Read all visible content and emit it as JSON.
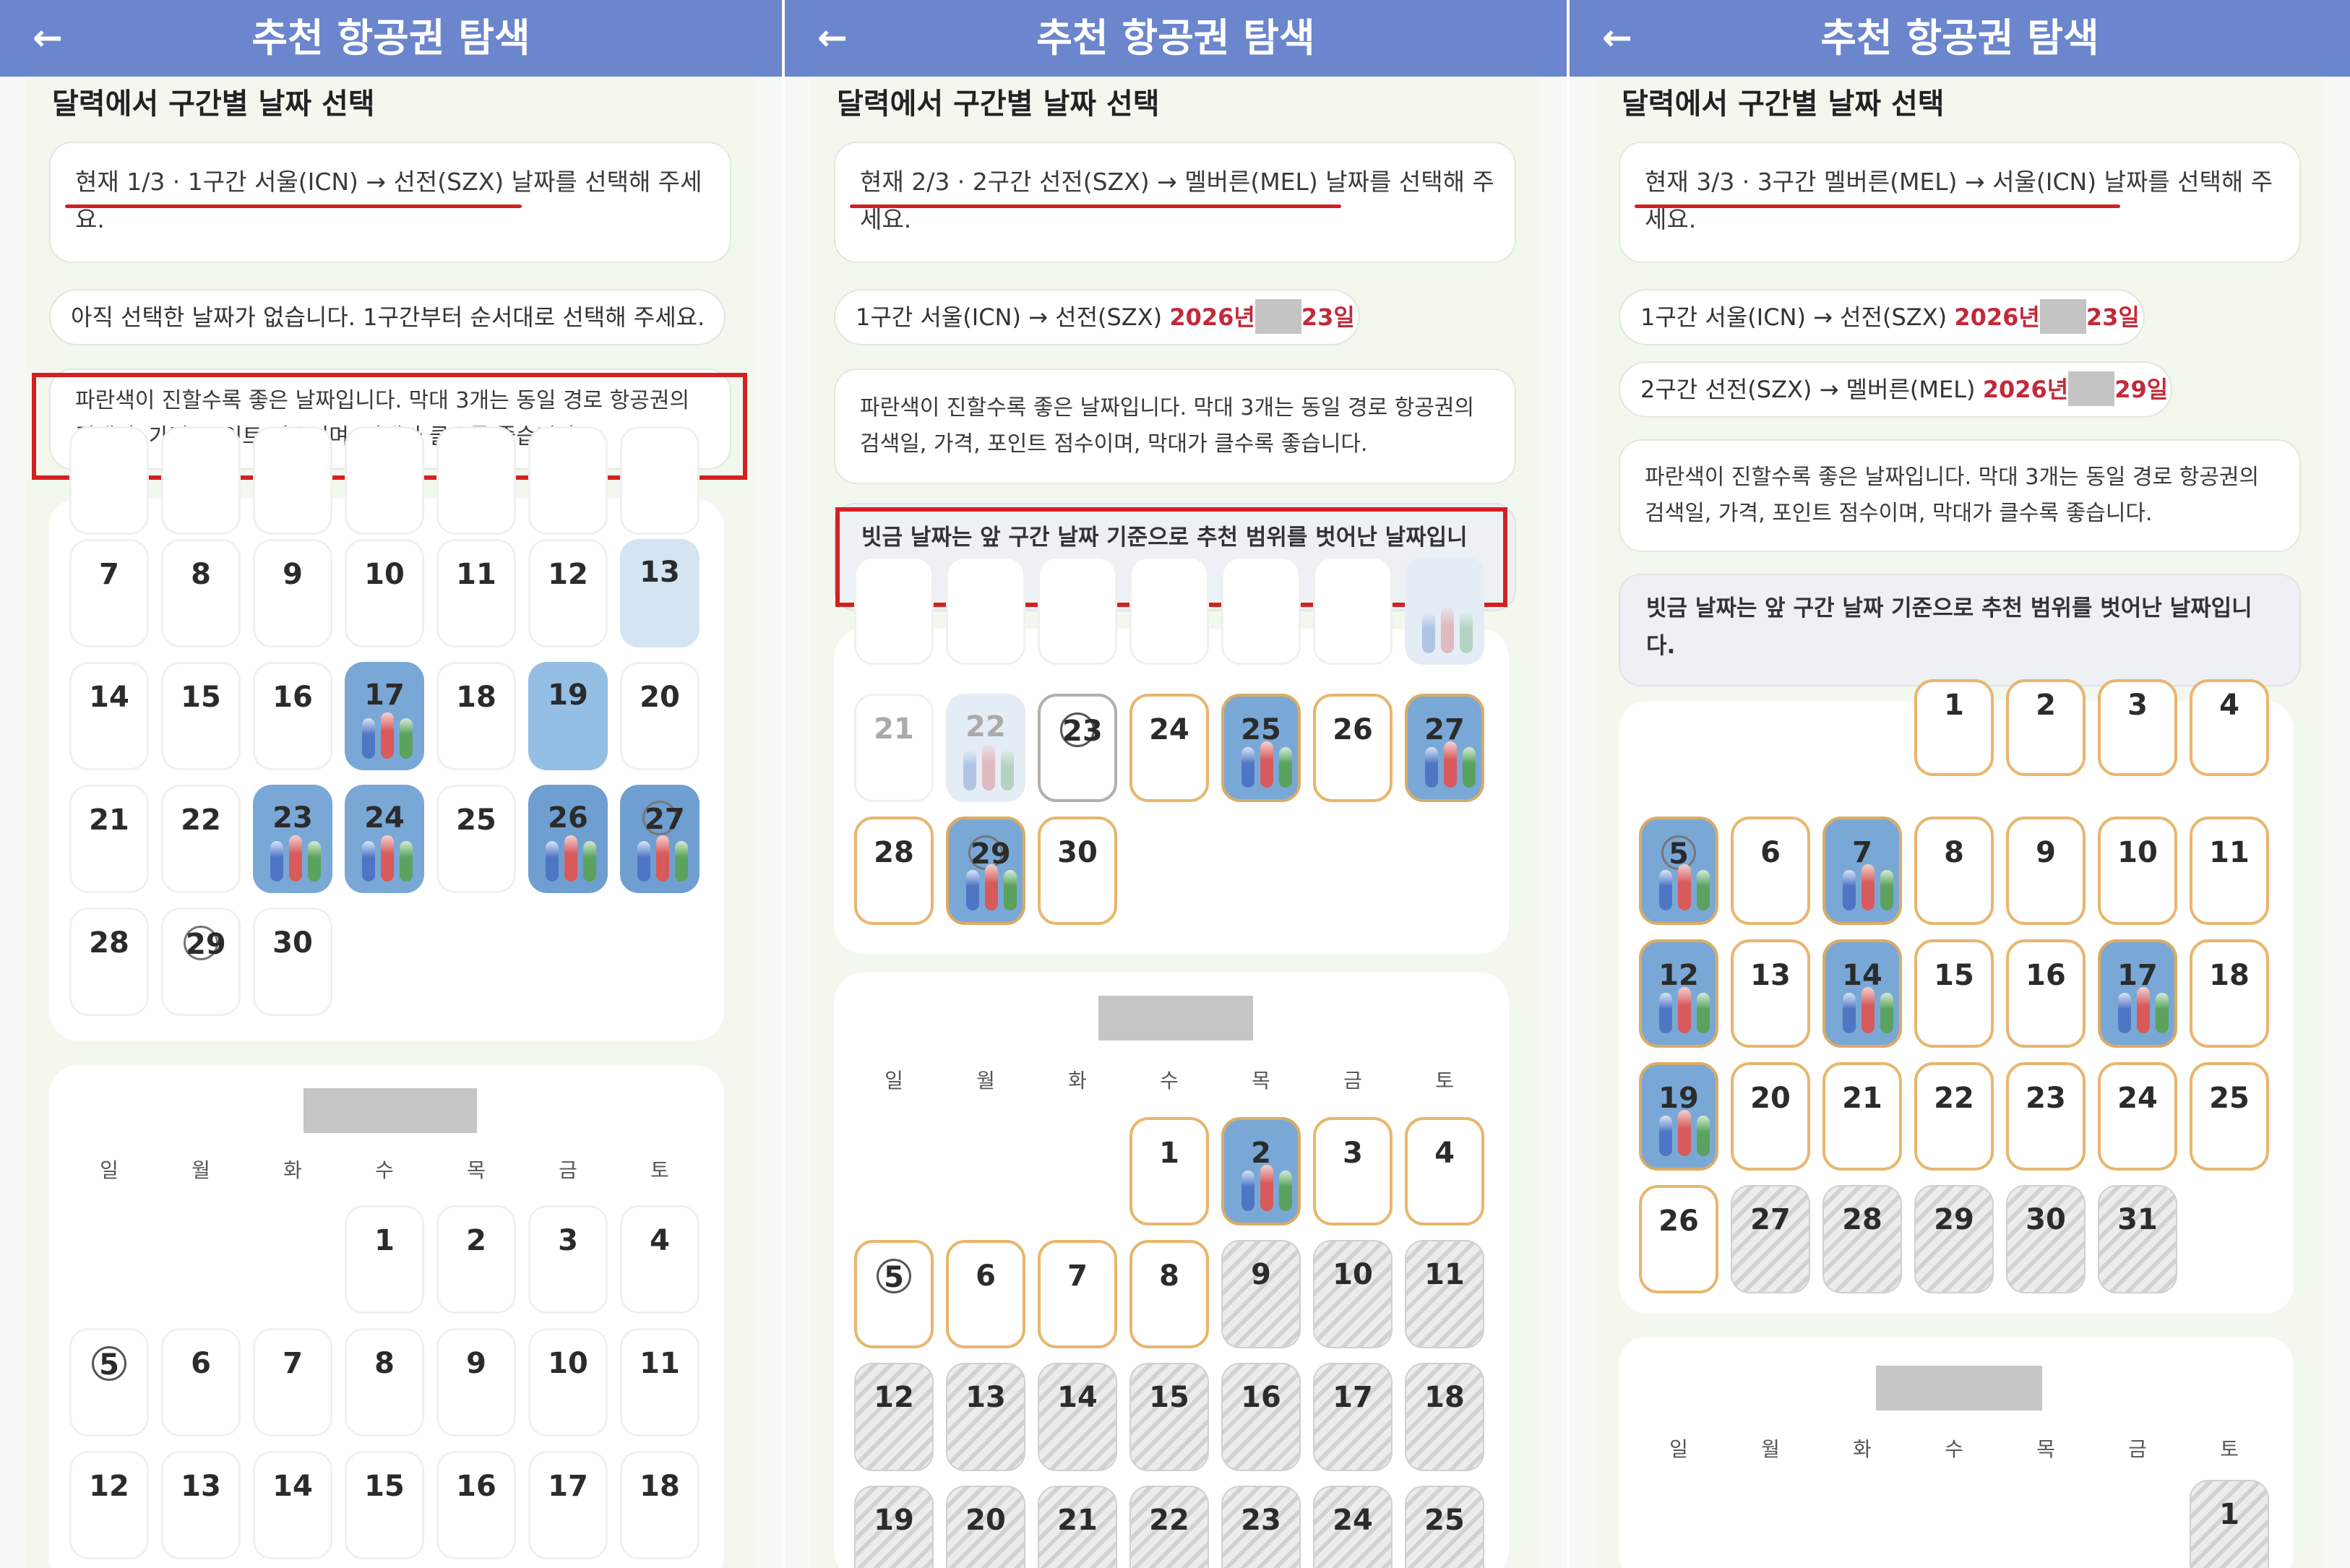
{
  "panels": [
    {
      "header_title": "추천 항공권 탐색",
      "back_icon": "arrow-left-icon",
      "section_title": "달력에서 구간별 날짜 선택",
      "current_step_text": "현재 1/3 · 1구간 서울(ICN) → 선전(SZX) 날짜를 선택해 주세요.",
      "selected_status": "아직 선택한 날짜가 없습니다. 1구간부터 순서대로 선택해 주세요.",
      "legend_text": "파란색이 진할수록 좋은 날짜입니다. 막대 3개는 동일 경로 항공권의 검색일, 가격, 포인트 점수이며, 막대가 클수록 좋습니다.",
      "month1_days": [
        "7",
        "8",
        "9",
        "10",
        "11",
        "12",
        "13",
        "14",
        "15",
        "16",
        "17",
        "18",
        "19",
        "20",
        "21",
        "22",
        "23",
        "24",
        "25",
        "26",
        "27",
        "28",
        "29",
        "30"
      ],
      "weekdays": [
        "일",
        "월",
        "화",
        "수",
        "목",
        "금",
        "토"
      ],
      "month2_days": [
        "1",
        "2",
        "3",
        "4",
        "5",
        "6",
        "7",
        "8",
        "9",
        "10",
        "11",
        "12",
        "13",
        "14",
        "15",
        "16",
        "17",
        "18"
      ]
    },
    {
      "header_title": "추천 항공권 탐색",
      "back_icon": "arrow-left-icon",
      "section_title": "달력에서 구간별 날짜 선택",
      "current_step_text": "현재 2/3 · 2구간 선전(SZX) → 멜버른(MEL) 날짜를 선택해 주세요.",
      "selected_leg1_route": "1구간 서울(ICN) → 선전(SZX)",
      "selected_leg1_year": "2026년",
      "selected_leg1_day": "23일",
      "legend_text": "파란색이 진할수록 좋은 날짜입니다. 막대 3개는 동일 경로 항공권의 검색일, 가격, 포인트 점수이며, 막대가 클수록 좋습니다.",
      "hatch_notice": "빗금 날짜는 앞 구간 날짜 기준으로 추천 범위를 벗어난 날짜입니다.",
      "month1_days": [
        "21",
        "22",
        "23",
        "24",
        "25",
        "26",
        "27",
        "28",
        "29",
        "30"
      ],
      "weekdays": [
        "일",
        "월",
        "화",
        "수",
        "목",
        "금",
        "토"
      ],
      "month2_days": [
        "1",
        "2",
        "3",
        "4",
        "5",
        "6",
        "7",
        "8",
        "9",
        "10",
        "11",
        "12",
        "13",
        "14",
        "15",
        "16",
        "17",
        "18",
        "19",
        "20",
        "21",
        "22",
        "23",
        "24",
        "25"
      ]
    },
    {
      "header_title": "추천 항공권 탐색",
      "back_icon": "arrow-left-icon",
      "section_title": "달력에서 구간별 날짜 선택",
      "current_step_text": "현재 3/3 · 3구간 멜버른(MEL) → 서울(ICN) 날짜를 선택해 주세요.",
      "selected_leg1_route": "1구간 서울(ICN) → 선전(SZX)",
      "selected_leg1_year": "2026년",
      "selected_leg1_day": "23일",
      "selected_leg2_route": "2구간 선전(SZX) → 멜버른(MEL)",
      "selected_leg2_year": "2026년",
      "selected_leg2_day": "29일",
      "legend_text": "파란색이 진할수록 좋은 날짜입니다. 막대 3개는 동일 경로 항공권의 검색일, 가격, 포인트 점수이며, 막대가 클수록 좋습니다.",
      "hatch_notice": "빗금 날짜는 앞 구간 날짜 기준으로 추천 범위를 벗어난 날짜입니다.",
      "month1_days": [
        "1",
        "2",
        "3",
        "4",
        "5",
        "6",
        "7",
        "8",
        "9",
        "10",
        "11",
        "12",
        "13",
        "14",
        "15",
        "16",
        "17",
        "18",
        "19",
        "20",
        "21",
        "22",
        "23",
        "24",
        "25",
        "26",
        "27",
        "28",
        "29",
        "30",
        "31"
      ],
      "weekdays": [
        "일",
        "월",
        "화",
        "수",
        "목",
        "금",
        "토"
      ],
      "month2_days": [
        "1"
      ]
    }
  ],
  "colors": {
    "header": "#6b86cc",
    "annotation_red": "#d42020",
    "range_border": "#e8b66e",
    "best_blue": "#7aa8d6"
  }
}
